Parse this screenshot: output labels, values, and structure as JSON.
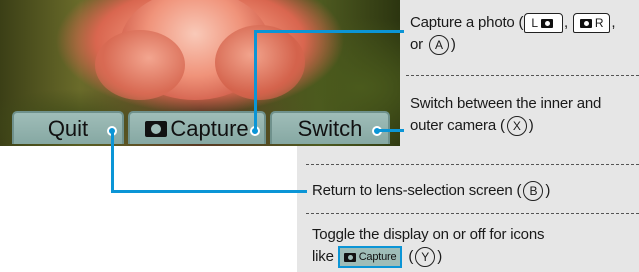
{
  "screen": {
    "buttons": {
      "quit": "Quit",
      "capture": "Capture",
      "switch": "Switch"
    }
  },
  "descriptions": {
    "capture": {
      "text_start": "Capture a photo (",
      "key_l": "L",
      "key_r": "R",
      "sep1": ",",
      "sep2": ",",
      "line2_prefix": "or",
      "button_a": "A",
      "close": ")"
    },
    "switch": {
      "line1": "Switch between the inner and",
      "line2_prefix": "outer camera (",
      "button_x": "X",
      "close": ")"
    },
    "quit": {
      "text": "Return to lens-selection screen (",
      "button_b": "B",
      "close": ")"
    },
    "toggle": {
      "line1": "Toggle the display on or off for icons",
      "line2_prefix": "like",
      "chip_label": "Capture",
      "open": "(",
      "button_y": "Y",
      "close": ")"
    }
  },
  "colors": {
    "accent": "#0b95d6",
    "button_face": "#9fbdb8",
    "panel": "#e6e6e6"
  },
  "icons": [
    "camera-icon",
    "a-button-icon",
    "b-button-icon",
    "x-button-icon",
    "y-button-icon",
    "l-button-icon",
    "r-button-icon"
  ]
}
